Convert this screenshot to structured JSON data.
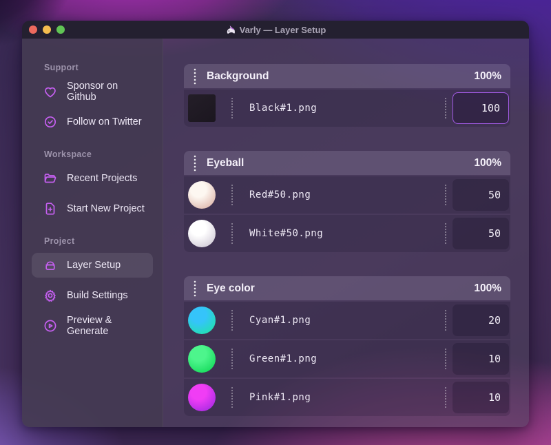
{
  "titlebar": {
    "title": "Varly — Layer Setup",
    "app_icon": "unicorn-icon",
    "traffic_lights": [
      "close",
      "minimize",
      "zoom"
    ]
  },
  "sidebar": {
    "sections": [
      {
        "label": "Support",
        "items": [
          {
            "icon": "heart-icon",
            "label": "Sponsor on Github",
            "active": false
          },
          {
            "icon": "badge-check-icon",
            "label": "Follow on Twitter",
            "active": false
          }
        ]
      },
      {
        "label": "Workspace",
        "items": [
          {
            "icon": "folder-icon",
            "label": "Recent Projects",
            "active": false
          },
          {
            "icon": "file-plus-icon",
            "label": "Start New Project",
            "active": false
          }
        ]
      },
      {
        "label": "Project",
        "items": [
          {
            "icon": "layers-icon",
            "label": "Layer Setup",
            "active": true
          },
          {
            "icon": "gear-icon",
            "label": "Build Settings",
            "active": false
          },
          {
            "icon": "play-circle-icon",
            "label": "Preview & Generate",
            "active": false
          }
        ]
      }
    ]
  },
  "main": {
    "groups": [
      {
        "name": "Background",
        "weight": "100%",
        "layers": [
          {
            "file": "Black#1.png",
            "value": "100",
            "focused": true,
            "thumb": "square",
            "thumb_colors": [
              "#241e28",
              "#1b161f"
            ]
          }
        ]
      },
      {
        "name": "Eyeball",
        "weight": "100%",
        "layers": [
          {
            "file": "Red#50.png",
            "value": "50",
            "focused": false,
            "thumb": "sphere",
            "thumb_colors": [
              "#fdf7f1",
              "#d9aca0"
            ]
          },
          {
            "file": "White#50.png",
            "value": "50",
            "focused": false,
            "thumb": "sphere",
            "thumb_colors": [
              "#ffffff",
              "#c9c2d0"
            ]
          }
        ]
      },
      {
        "name": "Eye color",
        "weight": "100%",
        "layers": [
          {
            "file": "Cyan#1.png",
            "value": "20",
            "focused": false,
            "thumb": "sphere",
            "thumb_colors": [
              "#35c4fa",
              "#1ee6a0"
            ]
          },
          {
            "file": "Green#1.png",
            "value": "10",
            "focused": false,
            "thumb": "sphere",
            "thumb_colors": [
              "#4df58c",
              "#0cd653"
            ]
          },
          {
            "file": "Pink#1.png",
            "value": "10",
            "focused": false,
            "thumb": "sphere",
            "thumb_colors": [
              "#f03df5",
              "#9c28df"
            ]
          }
        ]
      }
    ]
  },
  "colors": {
    "accent_purple": "#bf5af2",
    "focus_ring": "#a55ce8",
    "traffic_red": "#ed6a5e",
    "traffic_yellow": "#f5bd4f",
    "traffic_green": "#61c455",
    "desktop_magenta": "#b32fc0",
    "desktop_indigo": "#4d21a8",
    "desktop_pink_glow": "#e156ac"
  }
}
